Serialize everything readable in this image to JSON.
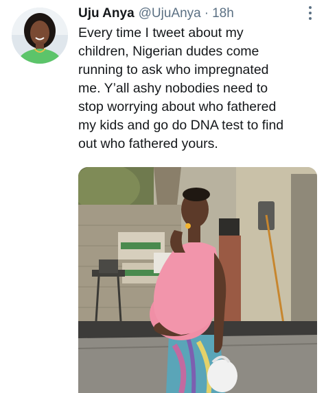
{
  "tweet": {
    "author": {
      "display_name": "Uju Anya",
      "handle": "@UjuAnya",
      "avatar_icon": "profile-photo"
    },
    "separator": "·",
    "timestamp": "18h",
    "more_icon": "vertical-ellipsis-icon",
    "text_lines": [
      "Every time I tweet about my",
      "children, Nigerian dudes come",
      "running to ask who impregnated",
      "me. Y’all ashy nobodies need to",
      "stop worrying about who fathered",
      "my kids and go do DNA test to find",
      "out who fathered yours."
    ],
    "media": {
      "kind": "photo"
    }
  },
  "colors": {
    "primary_text": "#14171a",
    "secondary_text": "#5b7083",
    "background": "#ffffff"
  }
}
